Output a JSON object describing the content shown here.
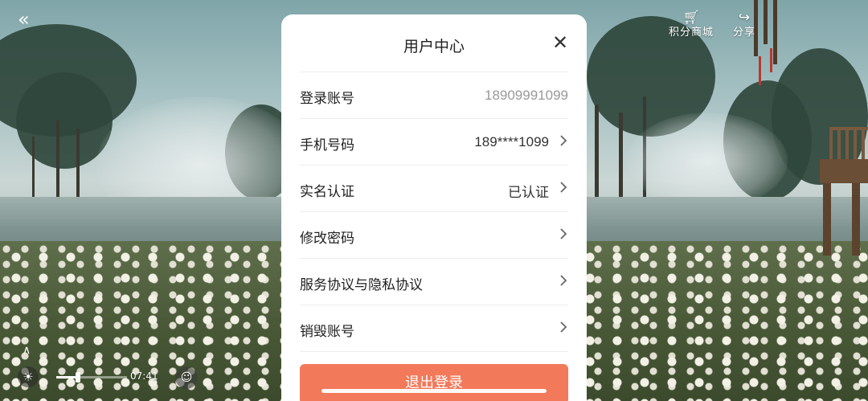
{
  "hud": {
    "back_icon": "back-arrows-icon",
    "points_mall": {
      "icon": "cart-icon",
      "label": "积分商城"
    },
    "share": {
      "icon": "share-icon",
      "label": "分享"
    },
    "time": "07:41"
  },
  "modal": {
    "title": "用户中心",
    "close_icon": "close-icon",
    "rows": [
      {
        "label": "登录账号",
        "value": "18909991099",
        "has_arrow": false
      },
      {
        "label": "手机号码",
        "value": "189****1099",
        "has_arrow": true
      },
      {
        "label": "实名认证",
        "value": "已认证",
        "has_arrow": true
      },
      {
        "label": "修改密码",
        "value": "",
        "has_arrow": true
      },
      {
        "label": "服务协议与隐私协议",
        "value": "",
        "has_arrow": true
      },
      {
        "label": "销毁账号",
        "value": "",
        "has_arrow": true
      }
    ],
    "logout_label": "退出登录"
  },
  "colors": {
    "logout_button": "#f2795a",
    "modal_background": "#ffffff",
    "muted_text": "#999999"
  }
}
